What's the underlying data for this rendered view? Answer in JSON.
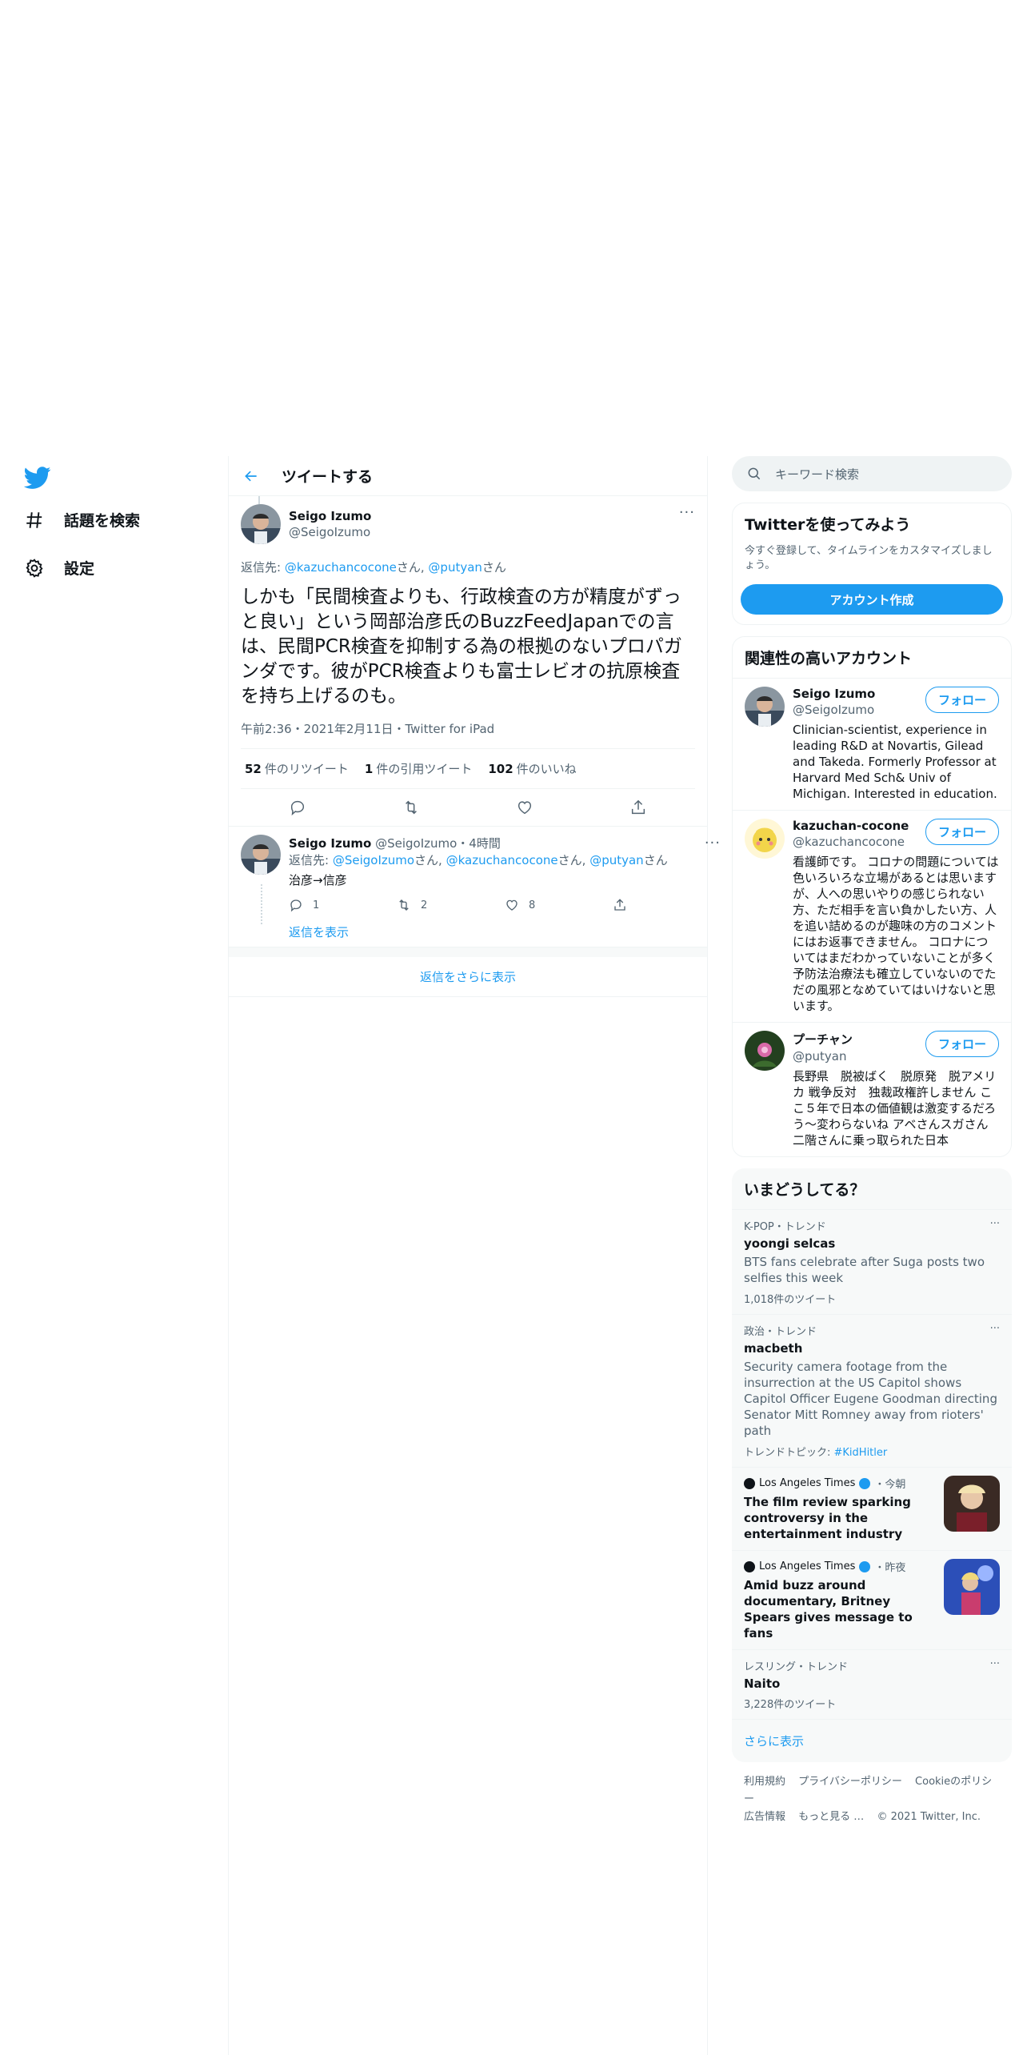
{
  "nav": {
    "explore_label": "話題を検索",
    "settings_label": "設定"
  },
  "header": {
    "title": "ツイートする"
  },
  "main_tweet": {
    "name": "Seigo Izumo",
    "handle": "@SeigoIzumo",
    "reply_prefix": "返信先: ",
    "reply_user1": "@kazuchancocone",
    "reply_san1": "さん, ",
    "reply_user2": "@putyan",
    "reply_san2": "さん",
    "text": "しかも「民間検査よりも、行政検査の方が精度がずっと良い」という岡部治彦氏のBuzzFeedJapanでの言は、民間PCR検査を抑制する為の根拠のないプロパガンダです。彼がPCR検査よりも富士レビオの抗原検査を持ち上げるのも。",
    "meta": "午前2:36・2021年2月11日・Twitter for iPad",
    "retweets_count": "52",
    "retweets_label": "件のリツイート",
    "quotes_count": "1",
    "quotes_label": "件の引用ツイート",
    "likes_count": "102",
    "likes_label": "件のいいね"
  },
  "reply": {
    "name": "Seigo Izumo",
    "handle_time": "@SeigoIzumo・4時間",
    "reply_prefix": "返信先: ",
    "reply_user1": "@SeigoIzumo",
    "reply_san1": "さん, ",
    "reply_user2": "@kazuchancocone",
    "reply_san2": "さん, ",
    "reply_user3": "@putyan",
    "reply_san3": "さん",
    "text": "治彦→信彦",
    "replies": "1",
    "retweets": "2",
    "likes": "8",
    "show_replies": "返信を表示"
  },
  "more_replies": "返信をさらに表示",
  "search": {
    "placeholder": "キーワード検索"
  },
  "signup": {
    "title": "Twitterを使ってみよう",
    "desc": "今すぐ登録して、タイムラインをカスタマイズしましょう。",
    "button": "アカウント作成"
  },
  "relevant": {
    "title": "関連性の高いアカウント",
    "follow_label": "フォロー",
    "accounts": [
      {
        "name": "Seigo Izumo",
        "handle": "@SeigoIzumo",
        "bio": "Clinician-scientist, experience in leading R&D at Novartis, Gilead and Takeda. Formerly Professor at Harvard Med Sch& Univ of Michigan. Interested in education."
      },
      {
        "name": "kazuchan-cocone",
        "handle": "@kazuchancocone",
        "bio": "看護師です。 コロナの問題については色いろいろな立場があるとは思いますが、人への思いやりの感じられない方、ただ相手を言い負かしたい方、人を追い詰めるのが趣味の方のコメントにはお返事できません。 コロナについてはまだわかっていないことが多く予防法治療法も確立していないのでただの風邪となめていてはいけないと思います。"
      },
      {
        "name": "プーチャン",
        "handle": "@putyan",
        "bio": "長野県　脱被ばく　脱原発　脱アメリカ 戦争反対　独裁政権許しません ここ５年で日本の価値観は激変するだろう～変わらないね アベさんスガさん二階さんに乗っ取られた日本"
      }
    ]
  },
  "trends": {
    "title": "いまどうしてる？",
    "t1": {
      "meta": "K-POP・トレンド",
      "name": "yoongi selcas",
      "desc": "BTS fans celebrate after Suga posts two selfies this week",
      "count": "1,018件のツイート"
    },
    "t2": {
      "meta": "政治・トレンド",
      "name": "macbeth",
      "desc": "Security camera footage from the insurrection at the US Capitol shows Capitol Officer Eugene Goodman directing Senator Mitt Romney away from rioters' path",
      "topic_prefix": "トレンドトピック: ",
      "topic": "#KidHitler"
    },
    "n1": {
      "source": "Los Angeles Times",
      "time": "・今朝",
      "title": "The film review sparking controversy in the entertainment industry"
    },
    "n2": {
      "source": "Los Angeles Times",
      "time": "・昨夜",
      "title": "Amid buzz around documentary, Britney Spears gives message to fans"
    },
    "t3": {
      "meta": "レスリング・トレンド",
      "name": "Naito",
      "count": "3,228件のツイート"
    },
    "show_more": "さらに表示"
  },
  "footer": {
    "terms": "利用規約",
    "privacy": "プライバシーポリシー",
    "cookie": "Cookieのポリシー",
    "ads": "広告情報",
    "more": "もっと見る …",
    "copyright": "© 2021 Twitter, Inc."
  },
  "colors": {
    "accent": "#1d9bf0",
    "text": "#0f1419",
    "muted": "#536471"
  }
}
